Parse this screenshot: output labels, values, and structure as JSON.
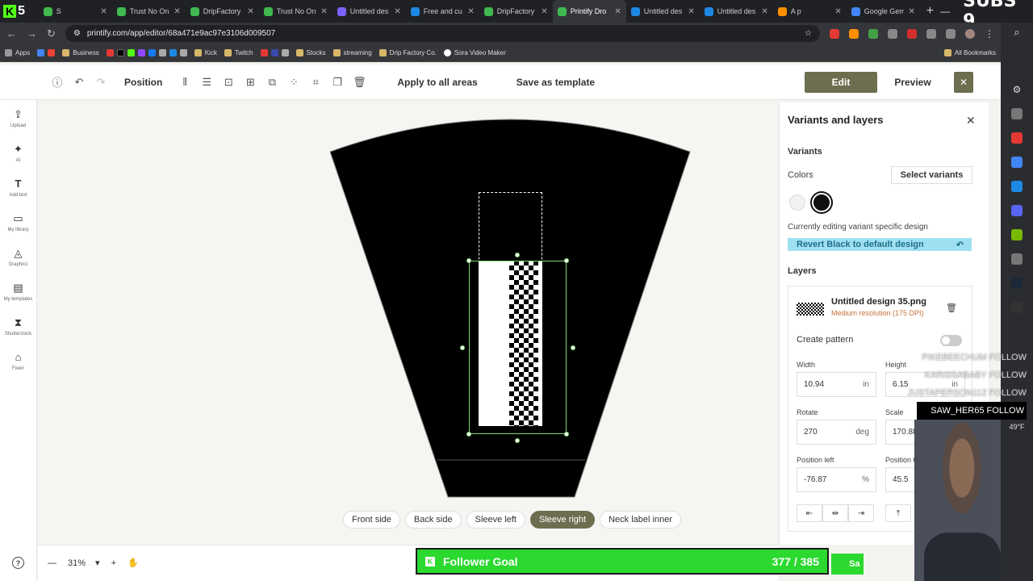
{
  "browser": {
    "tabs": [
      {
        "title": "S"
      },
      {
        "title": "Trust No On"
      },
      {
        "title": "DripFactory"
      },
      {
        "title": "Trust No On"
      },
      {
        "title": "Untitled des"
      },
      {
        "title": "Free and cu"
      },
      {
        "title": "DripFactory"
      },
      {
        "title": "Printify Dro",
        "active": true
      },
      {
        "title": "Untitled des"
      },
      {
        "title": "Untitled des"
      },
      {
        "title": "A p"
      },
      {
        "title": "Google Gem"
      }
    ],
    "badge": "5",
    "subs_overlay": "SUBS 9",
    "url": "printify.com/app/editor/68a471e9ac97e3106d009507",
    "bookmarks": [
      "Apps",
      "Business",
      "Kick",
      "Twitch",
      "Stocks",
      "streaming",
      "Drip Factory Co.",
      "Sora Video Maker"
    ],
    "all_bookmarks": "All Bookmarks",
    "weather": "49°F"
  },
  "toolbar": {
    "position_label": "Position",
    "apply_label": "Apply to all areas",
    "save_template_label": "Save as template",
    "edit_label": "Edit",
    "preview_label": "Preview"
  },
  "leftbar": {
    "items": [
      "Upload",
      "AI",
      "Add text",
      "My library",
      "Graphics",
      "My templates",
      "Shutterstock",
      "Fiverr"
    ]
  },
  "side_tabs": [
    "Front side",
    "Back side",
    "Sleeve left",
    "Sleeve right",
    "Neck label inner"
  ],
  "active_side": "Sleeve right",
  "zoom": "31%",
  "panel": {
    "title": "Variants and layers",
    "variants_heading": "Variants",
    "colors_label": "Colors",
    "select_variants": "Select variants",
    "colors": [
      "#f2f2f2",
      "#111111"
    ],
    "editing_note": "Currently editing variant specific design",
    "revert_label": "Revert Black to default design",
    "layers_heading": "Layers",
    "layer": {
      "name": "Untitled design 35.png",
      "resolution": "Medium resolution (175 DPI)"
    },
    "create_pattern": "Create pattern",
    "fields": {
      "width_label": "Width",
      "width": "10.94",
      "width_unit": "in",
      "height_label": "Height",
      "height": "6.15",
      "height_unit": "in",
      "rotate_label": "Rotate",
      "rotate": "270",
      "rotate_unit": "deg",
      "scale_label": "Scale",
      "scale": "170.88",
      "left_label": "Position left",
      "left": "-76.87",
      "left_unit": "%",
      "top_label": "Position top",
      "top": "45.5"
    }
  },
  "overlay": {
    "goal_label": "Follower Goal",
    "goal_count": "377 / 385",
    "follows": [
      {
        "name": "PIKEBEECHUM",
        "action": "FOLLOW"
      },
      {
        "name": "KARISSABABY",
        "action": "FOLLOW"
      },
      {
        "name": "JUSTAPERSON112",
        "action": "FOLLOW"
      },
      {
        "name": "SAW_HER65",
        "action": "FOLLOW"
      }
    ],
    "save_partial": "Sa"
  }
}
